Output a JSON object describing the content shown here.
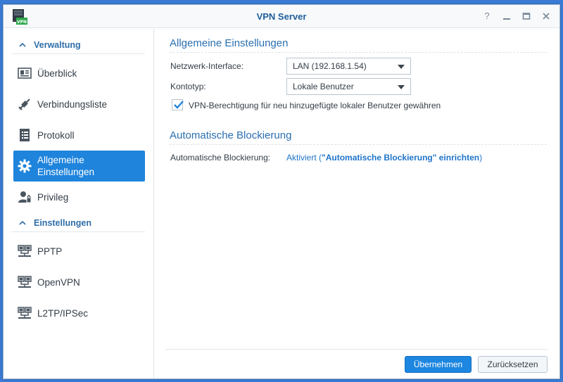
{
  "window": {
    "title": "VPN Server",
    "app_icon_text": "VPN",
    "controls": {
      "help": "?",
      "minimize": "—",
      "maximize": "□",
      "close": "✕"
    }
  },
  "sidebar": {
    "sections": [
      {
        "label": "Verwaltung"
      },
      {
        "label": "Einstellungen"
      }
    ],
    "items": [
      {
        "label": "Überblick",
        "icon": "overview-icon"
      },
      {
        "label": "Verbindungsliste",
        "icon": "connection-list-icon"
      },
      {
        "label": "Protokoll",
        "icon": "log-icon"
      },
      {
        "label": "Allgemeine Einstellungen",
        "icon": "gear-icon",
        "active": true
      },
      {
        "label": "Privileg",
        "icon": "privilege-icon"
      },
      {
        "label": "PPTP",
        "icon": "network-icon"
      },
      {
        "label": "OpenVPN",
        "icon": "network-icon"
      },
      {
        "label": "L2TP/IPSec",
        "icon": "network-icon"
      }
    ]
  },
  "main": {
    "general": {
      "title": "Allgemeine Einstellungen",
      "network_interface_label": "Netzwerk-Interface:",
      "network_interface_value": "LAN (192.168.1.54)",
      "account_type_label": "Kontotyp:",
      "account_type_value": "Lokale Benutzer",
      "vpn_permission_label": "VPN-Berechtigung für neu hinzugefügte lokaler Benutzer gewähren",
      "vpn_permission_checked": true
    },
    "autoblock": {
      "title": "Automatische Blockierung",
      "label": "Automatische Blockierung:",
      "value_prefix": "Aktiviert (",
      "link_text": "\"Automatische Blockierung\" einrichten",
      "value_suffix": ")"
    }
  },
  "footer": {
    "apply_label": "Übernehmen",
    "reset_label": "Zurücksetzen"
  },
  "colors": {
    "accent": "#1f84dc",
    "title_text": "#1f5f9b",
    "link": "#1e74c9",
    "background": "#3a7bd5"
  }
}
